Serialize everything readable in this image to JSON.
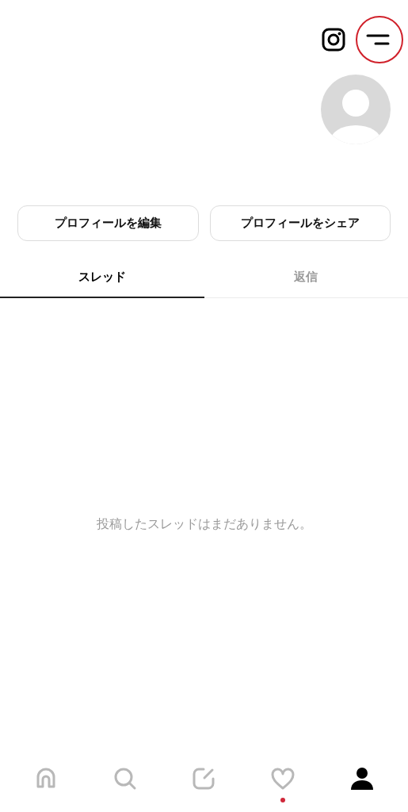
{
  "top_bar": {
    "icons": [
      {
        "kind": "instagram"
      },
      {
        "kind": "menu",
        "highlighted": true
      }
    ]
  },
  "profile": {
    "avatar": {
      "kind": "placeholder"
    }
  },
  "buttons": [
    "プロフィールを編集",
    "プロフィールをシェア"
  ],
  "tabs": [
    {
      "label": "スレッド",
      "selected": true
    },
    {
      "label": "返信",
      "selected": false
    }
  ],
  "empty_message": "投稿したスレッドはまだありません。",
  "bottom_nav": [
    {
      "kind": "home",
      "selected": false,
      "notification": false
    },
    {
      "kind": "search",
      "selected": false,
      "notification": false
    },
    {
      "kind": "compose",
      "selected": false,
      "notification": false
    },
    {
      "kind": "activity",
      "selected": false,
      "notification": true
    },
    {
      "kind": "profile",
      "selected": true,
      "notification": false
    }
  ]
}
